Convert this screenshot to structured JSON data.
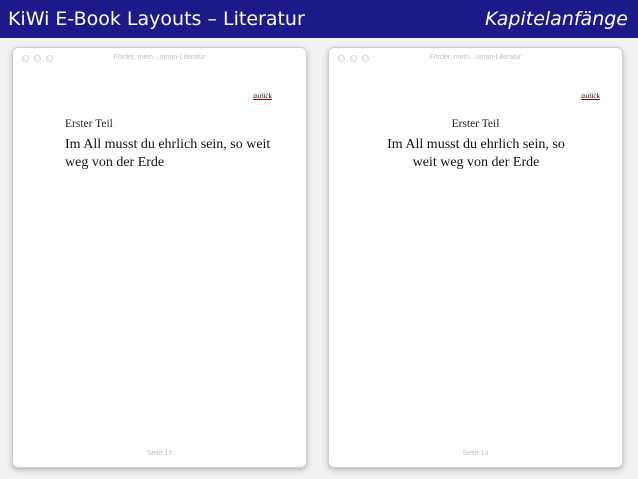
{
  "header": {
    "title": "KiWi E-Book Layouts – Literatur",
    "subtitle": "Kapitelanfänge"
  },
  "windows": [
    {
      "title": "Förder, mein…oman-Literatur",
      "back_link": "zurück",
      "part": "Erster Teil",
      "chapter_title": "Im All musst du ehrlich sein, so weit weg von der Erde",
      "alignment": "left",
      "page": "Seite 16"
    },
    {
      "title": "Förder, mein…oman-Literatur",
      "back_link": "zurück",
      "part": "Erster Teil",
      "chapter_title": "Im All musst du ehrlich sein, so weit weg von der Erde",
      "alignment": "center",
      "page": "Seite 14"
    }
  ],
  "colors": {
    "header_background": "#1c1a8a",
    "header_text": "#ffffff",
    "link_underline": "#b00000"
  }
}
